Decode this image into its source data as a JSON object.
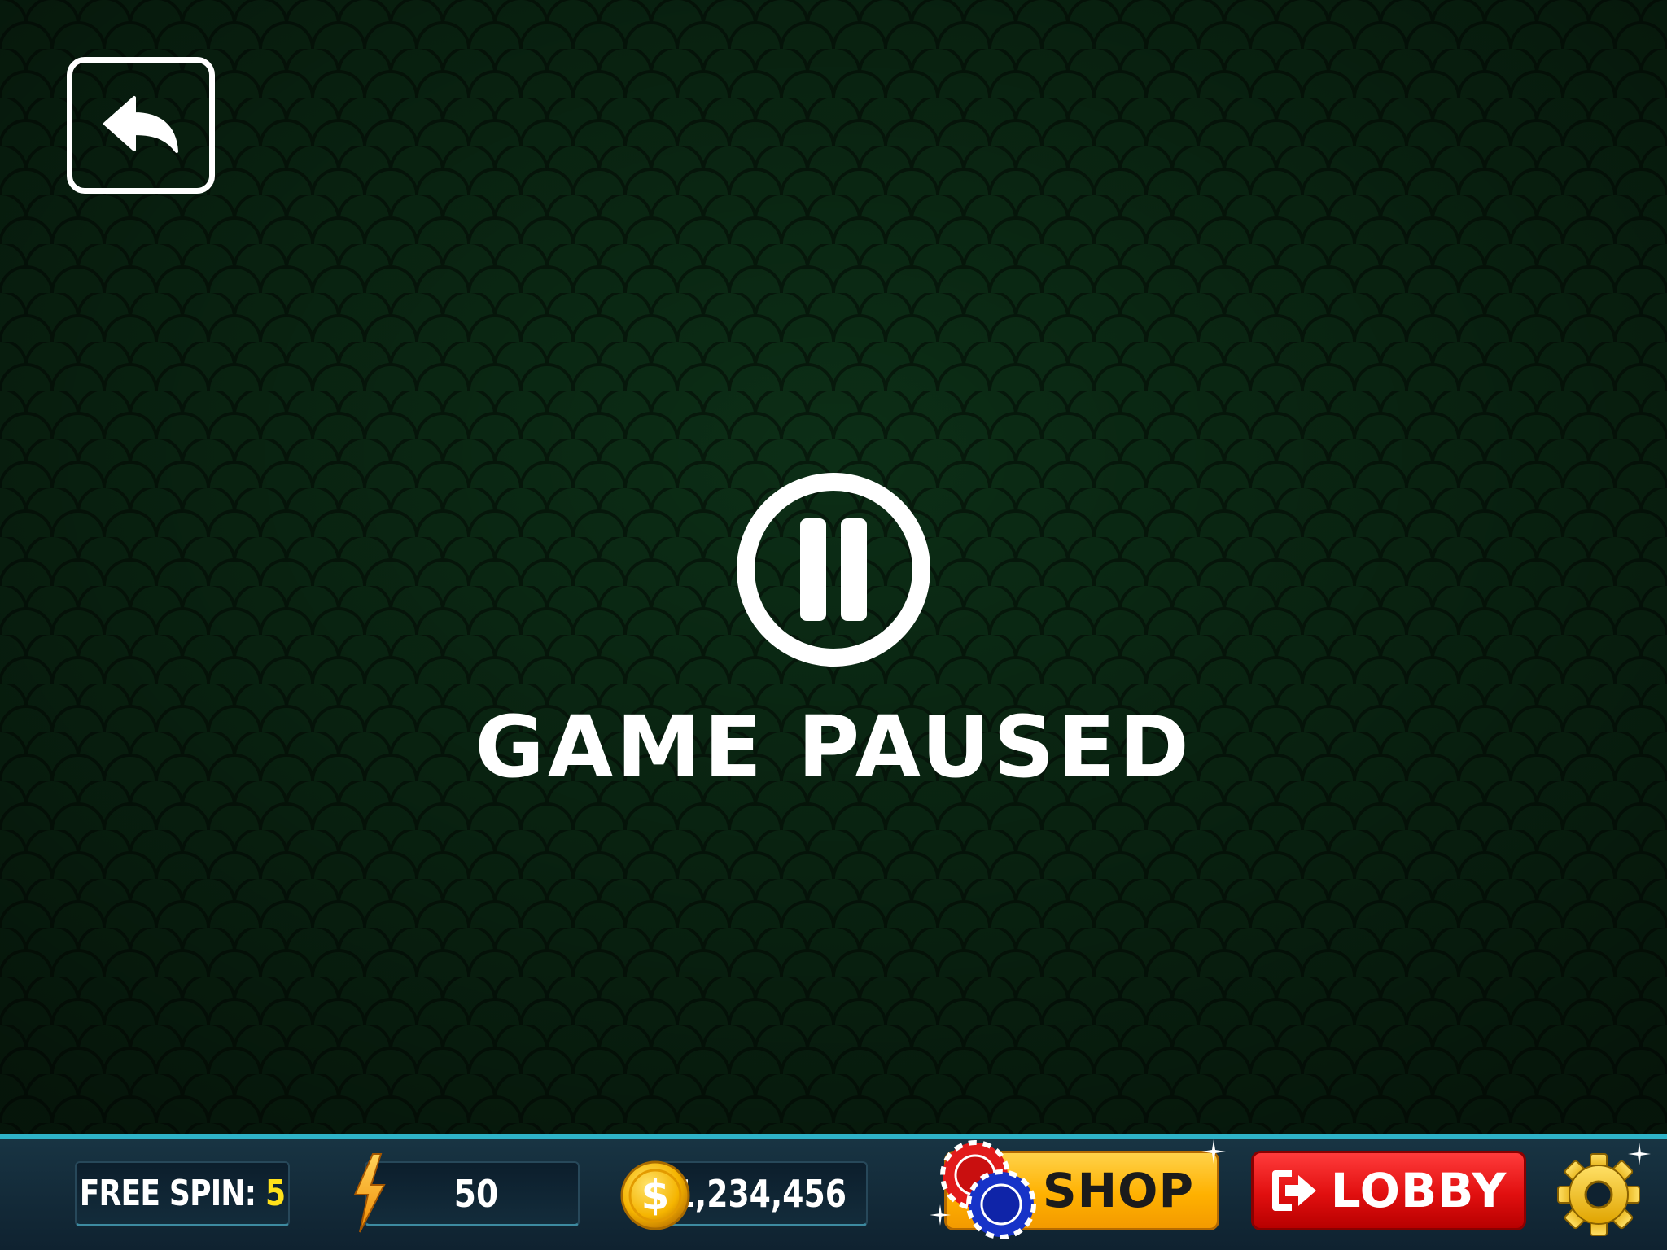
{
  "screen": {
    "title": "GAME PAUSED"
  },
  "icons": {
    "back": "back-arrow-icon",
    "pause": "pause-icon",
    "energy": "lightning-bolt-icon",
    "coin": "dollar-coin-icon",
    "chips": "poker-chips-icon",
    "exit": "exit-icon",
    "settings": "gear-icon"
  },
  "status_bar": {
    "free_spin_label": "FREE SPIN:",
    "free_spin_count": "5",
    "energy_value": "50",
    "coin_balance": "1,234,456"
  },
  "buttons": {
    "shop_label": "SHOP",
    "lobby_label": "LOBBY"
  },
  "colors": {
    "background": "#0a2412",
    "accent_line": "#2fb3c8",
    "free_spin_count": "#ffe11a",
    "shop": "#ffb100",
    "lobby": "#e10f0f",
    "gear": "#f5c518"
  }
}
